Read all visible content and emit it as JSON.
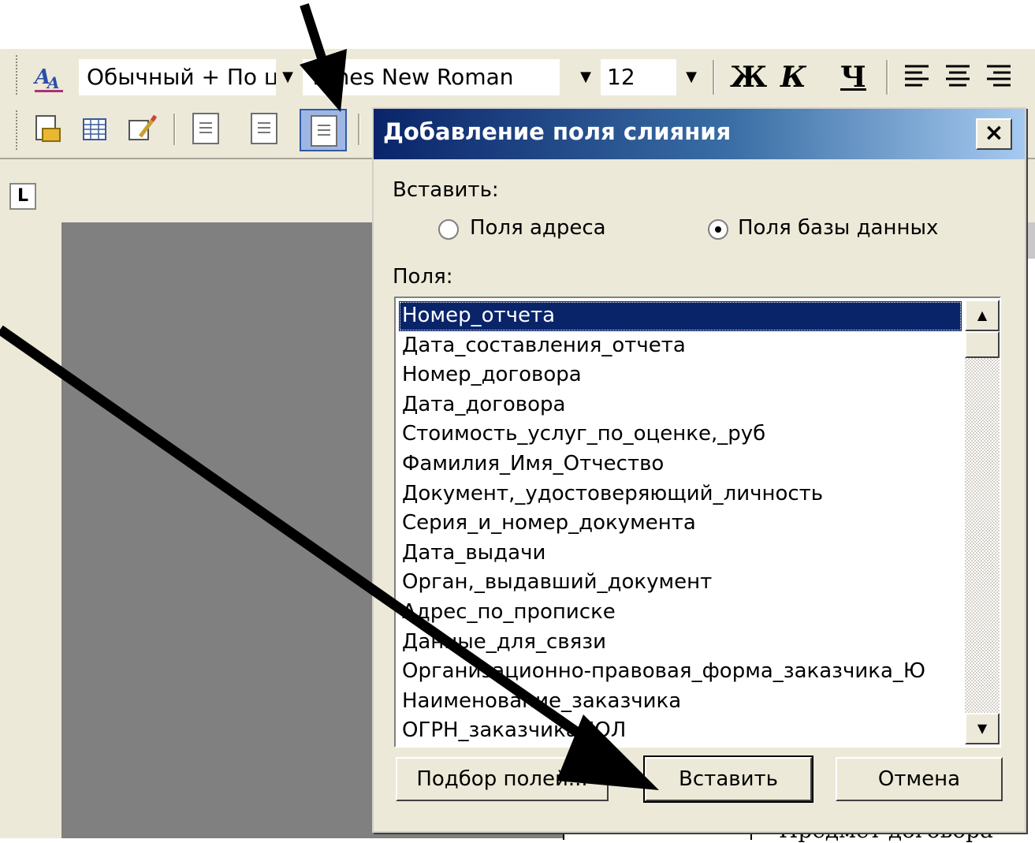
{
  "toolbar": {
    "style_value": "Обычный + По ц",
    "font_value": "Times New Roman",
    "size_value": "12",
    "bold": "Ж",
    "italic": "К",
    "underline": "Ч"
  },
  "ruler": {
    "tab_selector": "L"
  },
  "dialog": {
    "title": "Добавление поля слияния",
    "close": "×",
    "insert_label": "Вставить:",
    "radio_address": "Поля адреса",
    "radio_database": "Поля базы данных",
    "radio_selected": "database",
    "fields_label": "Поля:",
    "fields": [
      "Номер_отчета",
      "Дата_составления_отчета",
      "Номер_договора",
      "Дата_договора",
      "Стоимость_услуг_по_оценке,_руб",
      "Фамилия_Имя_Отчество",
      "Документ,_удостоверяющий_личность",
      "Серия_и_номер_документа",
      "Дата_выдачи",
      "Орган,_выдавший_документ",
      "Адрес_по_прописке",
      "Данные_для_связи",
      "Организационно-правовая_форма_заказчика_Ю",
      "Наименование_заказчика",
      "ОГРН_заказчика_ЮЛ"
    ],
    "selected_index": 0,
    "scroll_up": "▲",
    "scroll_down": "▼",
    "btn_fields": "Подбор полей...",
    "btn_insert": "Вставить",
    "btn_cancel": "Отмена"
  },
  "document": {
    "frag_bottom": "Предмет договора"
  },
  "colors": {
    "title_start": "#0a246a",
    "title_end": "#a6caf0",
    "selection": "#0a246a",
    "workspace": "#808080",
    "face": "#ece9d8"
  }
}
